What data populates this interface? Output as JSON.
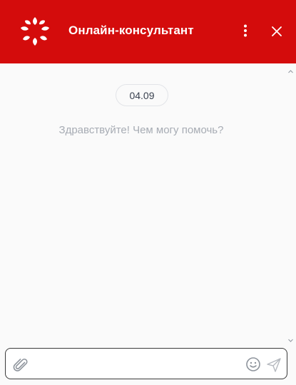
{
  "header": {
    "title": "Онлайн-консультант",
    "bg_color": "#d40c0c"
  },
  "chat": {
    "date": "04.09",
    "greeting": "Здравствуйте! Чем могу помочь?"
  },
  "composer": {
    "placeholder": "",
    "value": ""
  },
  "icons": {
    "logo": "brand-logo-icon",
    "menu": "more-vertical-icon",
    "close": "close-icon",
    "attach": "paperclip-icon",
    "emoji": "smiley-icon",
    "send": "send-icon",
    "scroll_up": "chevron-up-icon",
    "scroll_down": "chevron-down-icon"
  }
}
